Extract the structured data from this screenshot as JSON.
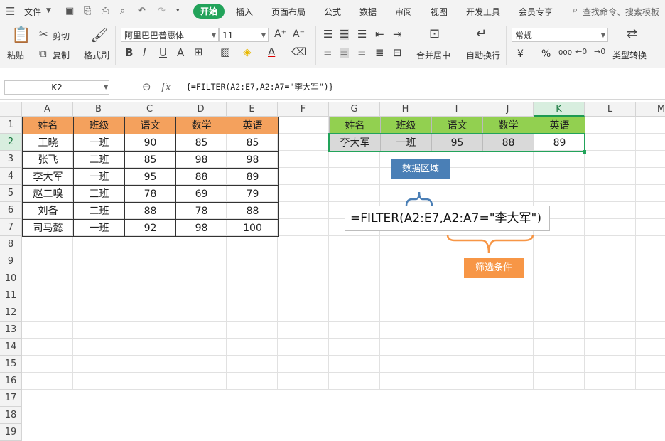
{
  "menu": {
    "file": "文件",
    "tabs": [
      "开始",
      "插入",
      "页面布局",
      "公式",
      "数据",
      "审阅",
      "视图",
      "开发工具",
      "会员专享"
    ],
    "search_placeholder": "查找命令、搜索模板"
  },
  "ribbon": {
    "paste": "粘贴",
    "cut": "剪切",
    "copy": "复制",
    "format_painter": "格式刷",
    "font_name": "阿里巴巴普惠体",
    "font_size": "11",
    "merge_center": "合并居中",
    "wrap_text": "自动换行",
    "number_format": "常规",
    "type_convert": "类型转换",
    "currency": "¥",
    "percent": "%",
    "thousands": "000"
  },
  "formula_bar": {
    "name_box": "K2",
    "fx": "fx",
    "formula": "{=FILTER(A2:E7,A2:A7=\"李大军\")}"
  },
  "columns": [
    "A",
    "B",
    "C",
    "D",
    "E",
    "F",
    "G",
    "H",
    "I",
    "J",
    "K",
    "L",
    "M"
  ],
  "rows": [
    "1",
    "2",
    "3",
    "4",
    "5",
    "6",
    "7",
    "8",
    "9",
    "10",
    "11",
    "12",
    "13",
    "14",
    "15",
    "16",
    "17",
    "18",
    "19"
  ],
  "source_table": {
    "headers": [
      "姓名",
      "班级",
      "语文",
      "数学",
      "英语"
    ],
    "rows": [
      [
        "王晓",
        "一班",
        "90",
        "85",
        "85"
      ],
      [
        "张飞",
        "二班",
        "85",
        "98",
        "98"
      ],
      [
        "李大军",
        "一班",
        "95",
        "88",
        "89"
      ],
      [
        "赵二嗅",
        "三班",
        "78",
        "69",
        "79"
      ],
      [
        "刘备",
        "二班",
        "88",
        "78",
        "88"
      ],
      [
        "司马懿",
        "一班",
        "92",
        "98",
        "100"
      ]
    ]
  },
  "result_table": {
    "headers": [
      "姓名",
      "班级",
      "语文",
      "数学",
      "英语"
    ],
    "row": [
      "李大军",
      "一班",
      "95",
      "88",
      "89"
    ]
  },
  "annotations": {
    "formula": "=FILTER(A2:E7,A2:A7=\"李大军\")",
    "range_label": "数据区域",
    "condition_label": "筛选条件"
  },
  "colors": {
    "source_header": "#f4a15d",
    "result_header": "#92d050",
    "result_row": "#d9d9d9",
    "range_note": "#4a7fb6",
    "condition_note": "#f79646",
    "active_tab": "#22a35a"
  }
}
